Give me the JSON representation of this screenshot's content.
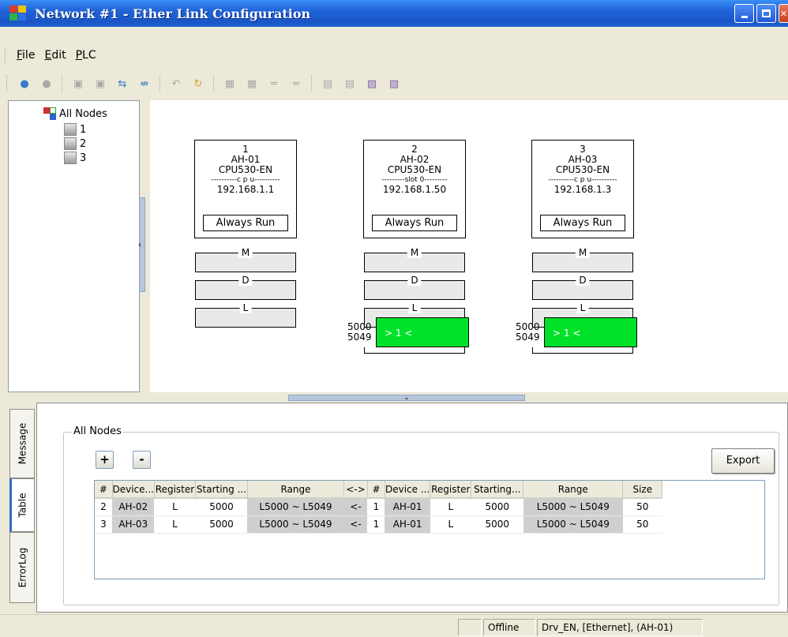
{
  "window": {
    "title": "Network #1 - Ether Link Configuration",
    "buttons": [
      "_",
      "□",
      "X"
    ]
  },
  "menu": [
    {
      "label": "File",
      "mnemonic": "F",
      "rest": "ile"
    },
    {
      "label": "Edit",
      "mnemonic": "E",
      "rest": "dit"
    },
    {
      "label": "PLC",
      "mnemonic": "P",
      "rest": "LC"
    }
  ],
  "toolbar_icons": [
    "online-icon",
    "offline-icon",
    "upload-icon",
    "download-icon",
    "link-icon",
    "unlink-icon",
    "undo-icon",
    "refresh-icon",
    "grid-icon",
    "grid2-icon",
    "align-left-icon",
    "align-right-icon",
    "copy-icon",
    "paste-icon",
    "export-icon",
    "import-icon"
  ],
  "tree": {
    "root": "All Nodes",
    "children": [
      "1",
      "2",
      "3"
    ]
  },
  "nodes": [
    {
      "num": "1",
      "name": "AH-01",
      "cpu": "CPU530-EN",
      "sep": "----------c p u----------",
      "ip": "192.168.1.1",
      "mode": "Always Run",
      "segments": [
        "M",
        "D",
        "L"
      ],
      "link": null
    },
    {
      "num": "2",
      "name": "AH-02",
      "cpu": "CPU530-EN",
      "sep": "---------slot 0---------",
      "ip": "192.168.1.50",
      "mode": "Always Run",
      "segments": [
        "M",
        "D",
        "L"
      ],
      "link": {
        "start": "5000",
        "end": "5049",
        "tag": "> 1 <"
      }
    },
    {
      "num": "3",
      "name": "AH-03",
      "cpu": "CPU530-EN",
      "sep": "----------c p u----------",
      "ip": "192.168.1.3",
      "mode": "Always Run",
      "segments": [
        "M",
        "D",
        "L"
      ],
      "link": {
        "start": "5000",
        "end": "5049",
        "tag": "> 1 <"
      }
    }
  ],
  "side_tabs": [
    "Message",
    "Table",
    "ErrorLog"
  ],
  "active_tab": "Table",
  "group_title": "All Nodes",
  "buttons": {
    "add": "+",
    "remove": "-",
    "export": "Export"
  },
  "table": {
    "columns": [
      "#",
      "Device...",
      "Register",
      "Starting ...",
      "Range",
      "<->",
      "#",
      "Device ...",
      "Register",
      "Starting...",
      "Range",
      "Size"
    ],
    "rows": [
      [
        "2",
        "AH-02",
        "L",
        "5000",
        "L5000 ~ L5049",
        "<-",
        "1",
        "AH-01",
        "L",
        "5000",
        "L5000 ~ L5049",
        "50"
      ],
      [
        "3",
        "AH-03",
        "L",
        "5000",
        "L5000 ~ L5049",
        "<-",
        "1",
        "AH-01",
        "L",
        "5000",
        "L5000 ~ L5049",
        "50"
      ]
    ]
  },
  "status": {
    "mode": "Offline",
    "driver": "Drv_EN, [Ethernet], (AH-01)"
  },
  "colors": {
    "link_green": "#00e12a",
    "title_blue": "#1f64d8"
  }
}
